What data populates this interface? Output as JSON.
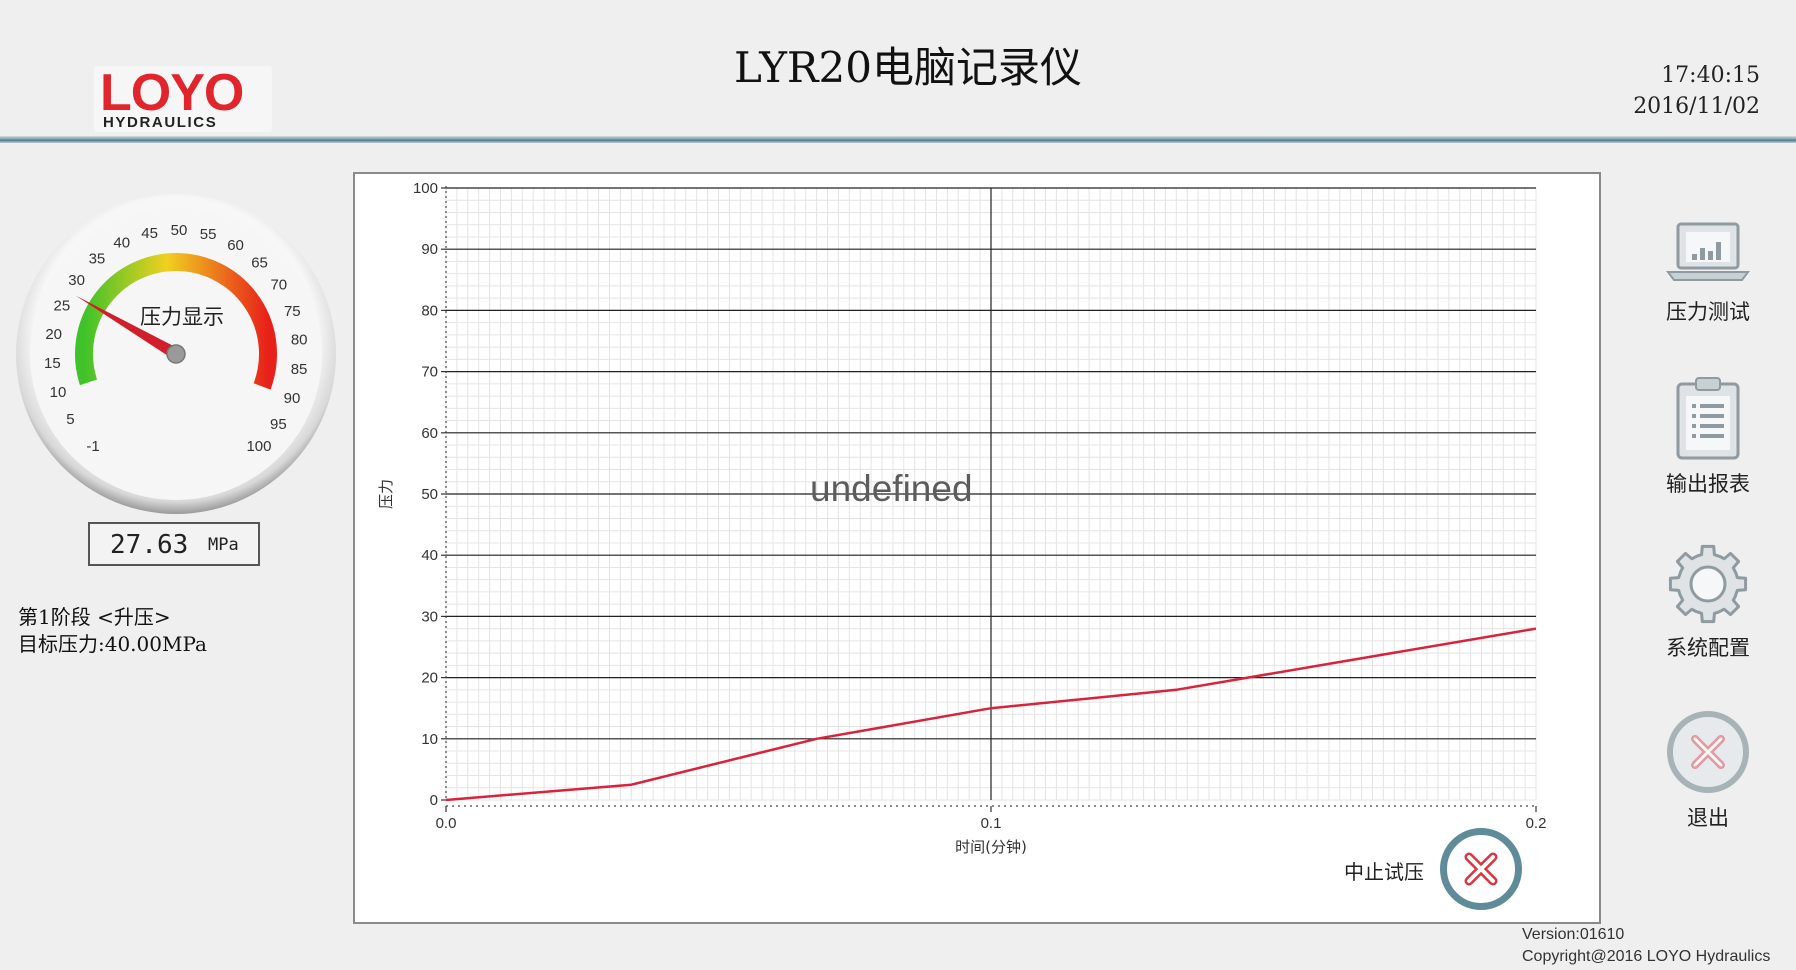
{
  "header": {
    "logo_main": "LOYO",
    "logo_sub": "HYDRAULICS",
    "title": "LYR20电脑记录仪",
    "time": "17:40:15",
    "date": "2016/11/02"
  },
  "gauge": {
    "label": "压力显示",
    "ticks": [
      "-1",
      "5",
      "10",
      "15",
      "20",
      "25",
      "30",
      "35",
      "40",
      "45",
      "50",
      "55",
      "60",
      "65",
      "70",
      "75",
      "80",
      "85",
      "90",
      "95",
      "100"
    ],
    "needle_value": 27.63,
    "colors": {
      "low": "#3fc22a",
      "mid": "#f0d020",
      "high": "#e8201a",
      "needle": "#d01e2a"
    }
  },
  "readout": {
    "value": "27.63",
    "unit": "MPa"
  },
  "stage": {
    "line1": "第1阶段 <升压>",
    "line2": "目标压力:40.00MPa"
  },
  "chart_data": {
    "type": "line",
    "xlabel": "时间(分钟)",
    "ylabel": "压力",
    "xlim": [
      0,
      0.2
    ],
    "ylim": [
      0,
      100
    ],
    "x_ticks": [
      "0.0",
      "0.1",
      "0.2"
    ],
    "y_ticks": [
      "0",
      "10",
      "20",
      "30",
      "40",
      "50",
      "60",
      "70",
      "80",
      "90",
      "100"
    ],
    "grid": true,
    "series": [
      {
        "color": "#d9233c",
        "x": [
          0,
          0.034,
          0.068,
          0.1,
          0.134,
          0.2
        ],
        "y": [
          0,
          2.5,
          10,
          15,
          18,
          28
        ]
      }
    ]
  },
  "overlay_text": "undefined",
  "abort": {
    "label": "中止试压"
  },
  "nav": [
    {
      "label": "压力测试",
      "icon": "laptop-chart-icon"
    },
    {
      "label": "输出报表",
      "icon": "clipboard-list-icon"
    },
    {
      "label": "系统配置",
      "icon": "gear-icon"
    },
    {
      "label": "退出",
      "icon": "close-circle-icon"
    }
  ],
  "footer": {
    "version": "Version:01610",
    "copyright": "Copyright@2016 LOYO Hydraulics"
  }
}
